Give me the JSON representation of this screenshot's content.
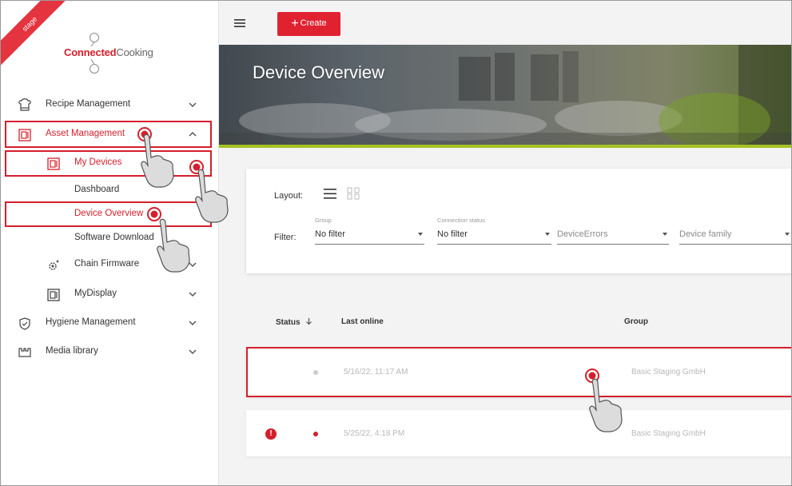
{
  "sidebar": {
    "stage_badge": "stage",
    "logo": {
      "strong": "Connected",
      "light": "Cooking"
    },
    "items": [
      {
        "label": "Recipe Management",
        "icon": "chef-hat-icon"
      },
      {
        "label": "Asset Management",
        "icon": "device-icon"
      },
      {
        "label": "My Devices",
        "icon": "device-icon"
      },
      {
        "label": "Dashboard"
      },
      {
        "label": "Device Overview"
      },
      {
        "label": "Software Download"
      },
      {
        "label": "Chain Firmware",
        "icon": "gear-icon"
      },
      {
        "label": "MyDisplay",
        "icon": "display-icon"
      },
      {
        "label": "Hygiene Management",
        "icon": "shield-check-icon"
      },
      {
        "label": "Media library",
        "icon": "media-folder-icon"
      }
    ]
  },
  "topbar": {
    "create_label": "Create",
    "menu_icon": "hamburger-icon"
  },
  "hero": {
    "title": "Device Overview"
  },
  "filters": {
    "layout_label": "Layout:",
    "filter_label": "Filter:",
    "selects": [
      {
        "caption": "Group",
        "value": "No filter"
      },
      {
        "caption": "Connection status",
        "value": "No filter"
      },
      {
        "caption": "",
        "value": "DeviceErrors"
      },
      {
        "caption": "",
        "value": "Device family"
      }
    ]
  },
  "table": {
    "headers": {
      "status": "Status",
      "last_online": "Last online",
      "group": "Group"
    },
    "sort_icon": "arrow-down-icon",
    "rows": [
      {
        "status_color": "#cccccc",
        "last_online": "5/16/22, 11:17 AM",
        "group": "Basic Staging GmbH",
        "error": false
      },
      {
        "status_color": "#d41f2c",
        "last_online": "5/25/22, 4:18 PM",
        "group": "Basic Staging GmbH",
        "error": true
      }
    ]
  },
  "colors": {
    "accent": "#d41f2c",
    "hero_bar": "#a5c324"
  }
}
